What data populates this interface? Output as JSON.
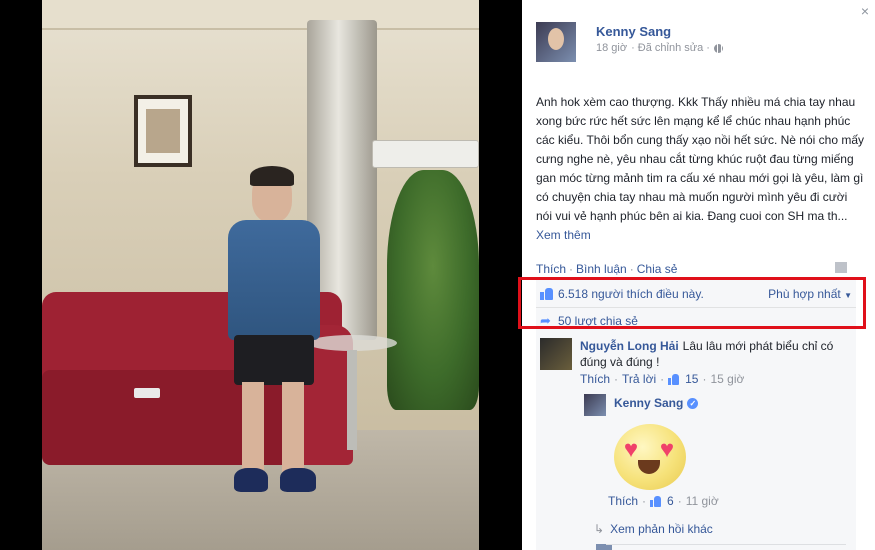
{
  "window": {
    "close_label": "×"
  },
  "post": {
    "author": "Kenny Sang",
    "time": "18 giờ",
    "edited": "· Đã chỉnh sửa ·",
    "text": "Anh hok xèm cao thượng. Kkk Thấy nhiều má chia tay nhau xong bức rức hết sức lên mạng kể lể chúc nhau hạnh phúc các kiểu. Thôi bổn cung thấy xạo nồi hết sức. Nè nói cho mấy cưng nghe nè, yêu nhau cắt từng khúc ruột đau từng miếng gan móc từng mảnh tim ra cấu xé nhau mới gọi là yêu, làm gì có chuyện chia tay nhau mà muốn người mình yêu đi cười nói vui vẻ hạnh phúc bên ai kia. Đang cuoi con SH ma th...",
    "see_more": "Xem thêm"
  },
  "actions": {
    "like": "Thích",
    "comment": "Bình luận",
    "share": "Chia sẻ",
    "sep": "·"
  },
  "ufi": {
    "likes": "6.518 người thích điều này.",
    "sort": "Phù hợp nhất",
    "shares": "50 lượt chia sẻ"
  },
  "comment": {
    "author": "Nguyễn Long Hải",
    "text": "Lâu lâu mới phát biểu chỉ có đúng và đúng !",
    "like": "Thích",
    "reply": "Trả lời",
    "likes_count": "15",
    "time": "15 giờ",
    "sep": "·"
  },
  "reply": {
    "author": "Kenny Sang",
    "like": "Thích",
    "likes_count": "6",
    "time": "11 giờ",
    "sep": "·"
  },
  "more_replies": "Xem phản hồi khác",
  "colors": {
    "link": "#365899",
    "highlight": "#e0101a",
    "panel_bg": "#ffffff",
    "ufi_bg": "#f6f7f9"
  }
}
